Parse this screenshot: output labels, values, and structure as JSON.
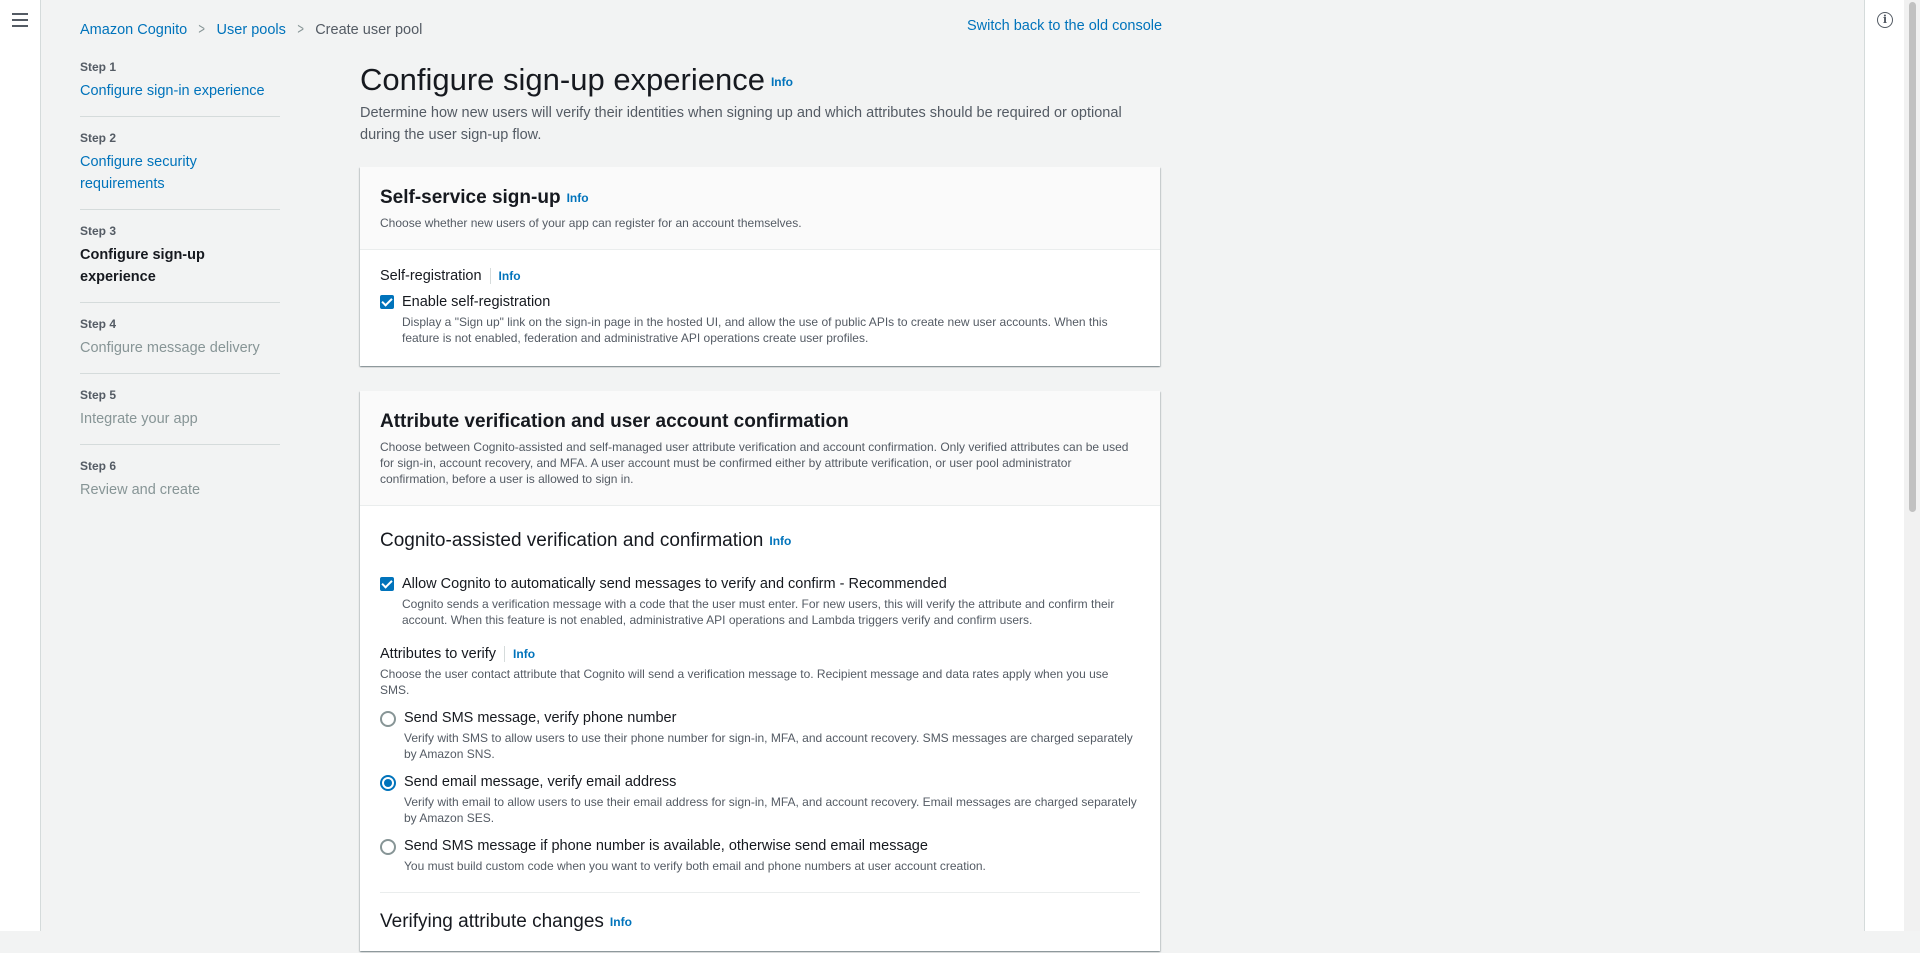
{
  "breadcrumb": {
    "items": [
      "Amazon Cognito",
      "User pools"
    ],
    "current": "Create user pool"
  },
  "switch_console": "Switch back to the old console",
  "steps": [
    {
      "num": "Step 1",
      "title": "Configure sign-in experience"
    },
    {
      "num": "Step 2",
      "title": "Configure security requirements"
    },
    {
      "num": "Step 3",
      "title": "Configure sign-up experience"
    },
    {
      "num": "Step 4",
      "title": "Configure message delivery"
    },
    {
      "num": "Step 5",
      "title": "Integrate your app"
    },
    {
      "num": "Step 6",
      "title": "Review and create"
    }
  ],
  "info_label": "Info",
  "page": {
    "title": "Configure sign-up experience",
    "description": "Determine how new users will verify their identities when signing up and which attributes should be required or optional during the user sign-up flow."
  },
  "self_service": {
    "title": "Self-service sign-up",
    "description": "Choose whether new users of your app can register for an account themselves.",
    "field_label": "Self-registration",
    "checkbox_label": "Enable self-registration",
    "checkbox_desc": "Display a \"Sign up\" link on the sign-in page in the hosted UI, and allow the use of public APIs to create new user accounts. When this feature is not enabled, federation and administrative API operations create user profiles."
  },
  "attr_verification": {
    "title": "Attribute verification and user account confirmation",
    "description": "Choose between Cognito-assisted and self-managed user attribute verification and account confirmation. Only verified attributes can be used for sign-in, account recovery, and MFA. A user account must be confirmed either by attribute verification, or user pool administrator confirmation, before a user is allowed to sign in.",
    "cognito_title": "Cognito-assisted verification and confirmation",
    "allow_label": "Allow Cognito to automatically send messages to verify and confirm - Recommended",
    "allow_desc": "Cognito sends a verification message with a code that the user must enter. For new users, this will verify the attribute and confirm their account. When this feature is not enabled, administrative API operations and Lambda triggers verify and confirm users.",
    "attrs_label": "Attributes to verify",
    "attrs_desc": "Choose the user contact attribute that Cognito will send a verification message to. Recipient message and data rates apply when you use SMS.",
    "options": [
      {
        "label": "Send SMS message, verify phone number",
        "desc": "Verify with SMS to allow users to use their phone number for sign-in, MFA, and account recovery. SMS messages are charged separately by Amazon SNS."
      },
      {
        "label": "Send email message, verify email address",
        "desc": "Verify with email to allow users to use their email address for sign-in, MFA, and account recovery. Email messages are charged separately by Amazon SES."
      },
      {
        "label": "Send SMS message if phone number is available, otherwise send email message",
        "desc": "You must build custom code when you want to verify both email and phone numbers at user account creation."
      }
    ],
    "selected_option": 1,
    "verifying_title": "Verifying attribute changes"
  }
}
